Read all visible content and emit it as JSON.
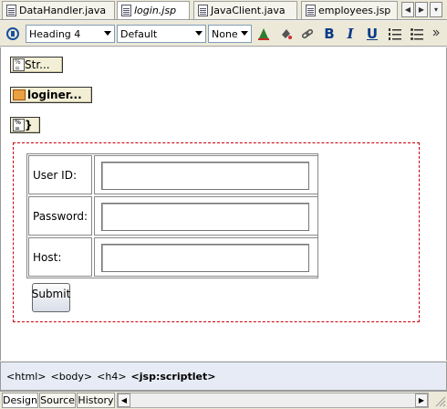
{
  "tabs": [
    {
      "label": "DataHandler.java",
      "active": false
    },
    {
      "label": "login.jsp",
      "active": true
    },
    {
      "label": "JavaClient.java",
      "active": false
    },
    {
      "label": "employees.jsp",
      "active": false
    }
  ],
  "toolbar": {
    "block_format": "Heading 4",
    "style": "Default",
    "css_class": "None",
    "icons": [
      "view-switch-icon",
      "bold-icon",
      "italic-icon",
      "underline-icon",
      "numbered-list-icon",
      "bulleted-list-icon",
      "highlight-icon",
      "fill-color-icon",
      "link-icon"
    ],
    "bold_label": "B",
    "italic_label": "I",
    "underline_label": "U"
  },
  "design": {
    "tag1": "Str...",
    "tag2": "loginer...",
    "tag3": "}",
    "form": {
      "rows": [
        {
          "label": "User ID:",
          "value": ""
        },
        {
          "label": "Password:",
          "value": ""
        },
        {
          "label": "Host:",
          "value": ""
        }
      ],
      "submit_label": "Submit"
    }
  },
  "breadcrumb": {
    "items": [
      "<html>",
      "<body>",
      "<h4>"
    ],
    "current": "<jsp:scriptlet>"
  },
  "bottom_tabs": [
    {
      "label": "Design",
      "active": true
    },
    {
      "label": "Source",
      "active": false
    },
    {
      "label": "History",
      "active": false
    }
  ]
}
